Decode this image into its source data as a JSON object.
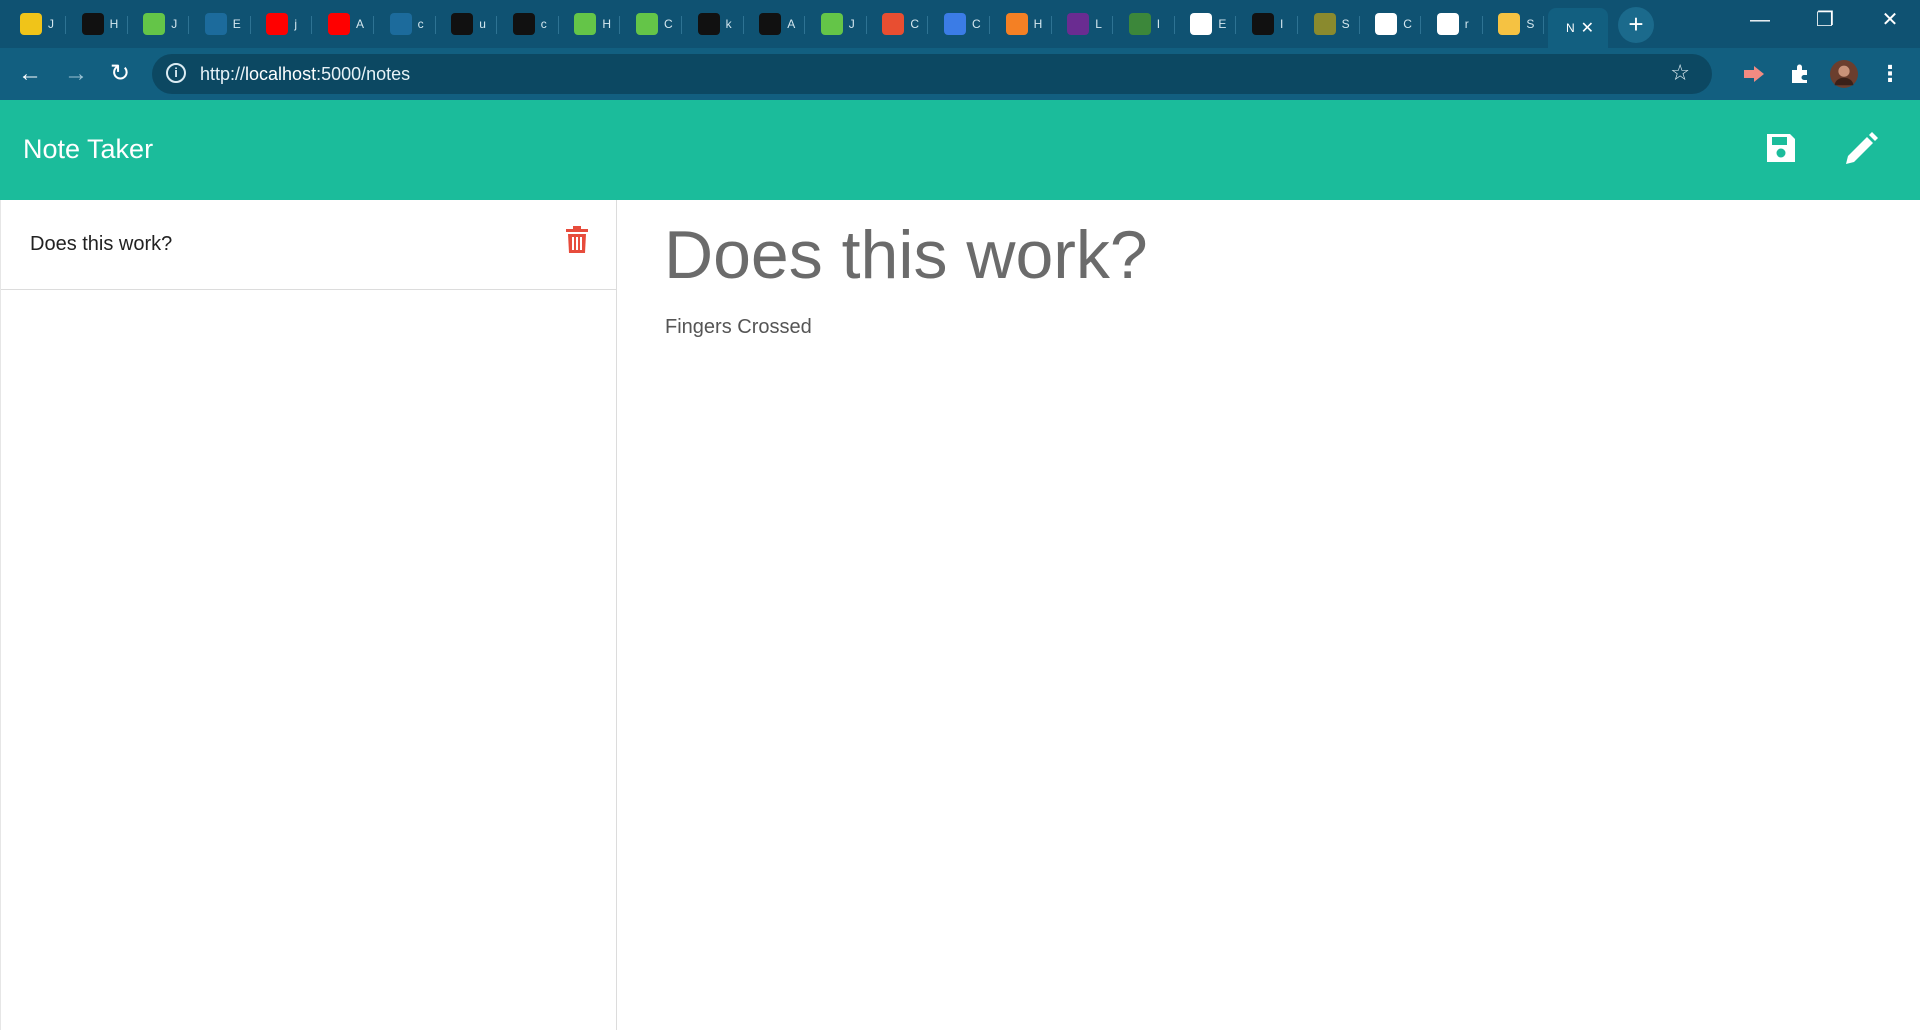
{
  "browser": {
    "tabs": [
      {
        "icon": "js-icon",
        "title": "J",
        "color": "#f0c419"
      },
      {
        "icon": "cheese-icon",
        "title": "H",
        "color": "#111111"
      },
      {
        "icon": "w3-icon",
        "title": "J",
        "color": "#64c548"
      },
      {
        "icon": "loading-icon",
        "title": "E",
        "color": "#1c6b9c"
      },
      {
        "icon": "youtube-icon",
        "title": "j",
        "color": "#ff0000"
      },
      {
        "icon": "youtube-icon",
        "title": "A",
        "color": "#ff0000"
      },
      {
        "icon": "loading-icon",
        "title": "c",
        "color": "#1c6b9c"
      },
      {
        "icon": "github-icon",
        "title": "u",
        "color": "#111111"
      },
      {
        "icon": "github-icon",
        "title": "c",
        "color": "#111111"
      },
      {
        "icon": "w3-icon",
        "title": "H",
        "color": "#64c548"
      },
      {
        "icon": "w3-icon",
        "title": "C",
        "color": "#64c548"
      },
      {
        "icon": "github-icon",
        "title": "k",
        "color": "#111111"
      },
      {
        "icon": "lambda-icon",
        "title": "A",
        "color": "#111111"
      },
      {
        "icon": "w3-icon",
        "title": "J",
        "color": "#64c548"
      },
      {
        "icon": "git-icon",
        "title": "C",
        "color": "#e84e31"
      },
      {
        "icon": "c-icon",
        "title": "C",
        "color": "#3b7ce6"
      },
      {
        "icon": "stack-icon",
        "title": "H",
        "color": "#f48024"
      },
      {
        "icon": "bootstrap-icon",
        "title": "L",
        "color": "#6a2c91"
      },
      {
        "icon": "node-icon",
        "title": "I",
        "color": "#3c873a"
      },
      {
        "icon": "google-icon",
        "title": "E",
        "color": "#ffffff"
      },
      {
        "icon": "github-icon",
        "title": "I",
        "color": "#111111"
      },
      {
        "icon": "notes-icon",
        "title": "S",
        "color": "#8a8a2e"
      },
      {
        "icon": "doc-icon",
        "title": "C",
        "color": "#ffffff"
      },
      {
        "icon": "google-icon",
        "title": "r",
        "color": "#ffffff"
      },
      {
        "icon": "weather-icon",
        "title": "S",
        "color": "#f5c242"
      }
    ],
    "active_tab": {
      "title": "N",
      "close": "✕"
    },
    "new_tab": "+",
    "window": {
      "minimize": "—",
      "restore": "❐",
      "close": "✕"
    },
    "nav": {
      "back": "←",
      "forward": "→",
      "reload": "↻"
    },
    "url_prefix": "http://",
    "url_host": "localhost",
    "url_rest": ":5000/notes",
    "info_glyph": "i",
    "star": "☆"
  },
  "app": {
    "title": "Note Taker",
    "accent": "#1bbc9b",
    "delete_color": "#e74c3c",
    "notes": [
      {
        "title": "Does this work?"
      }
    ],
    "active_note": {
      "title": "Does this work?",
      "text": "Fingers Crossed"
    }
  }
}
